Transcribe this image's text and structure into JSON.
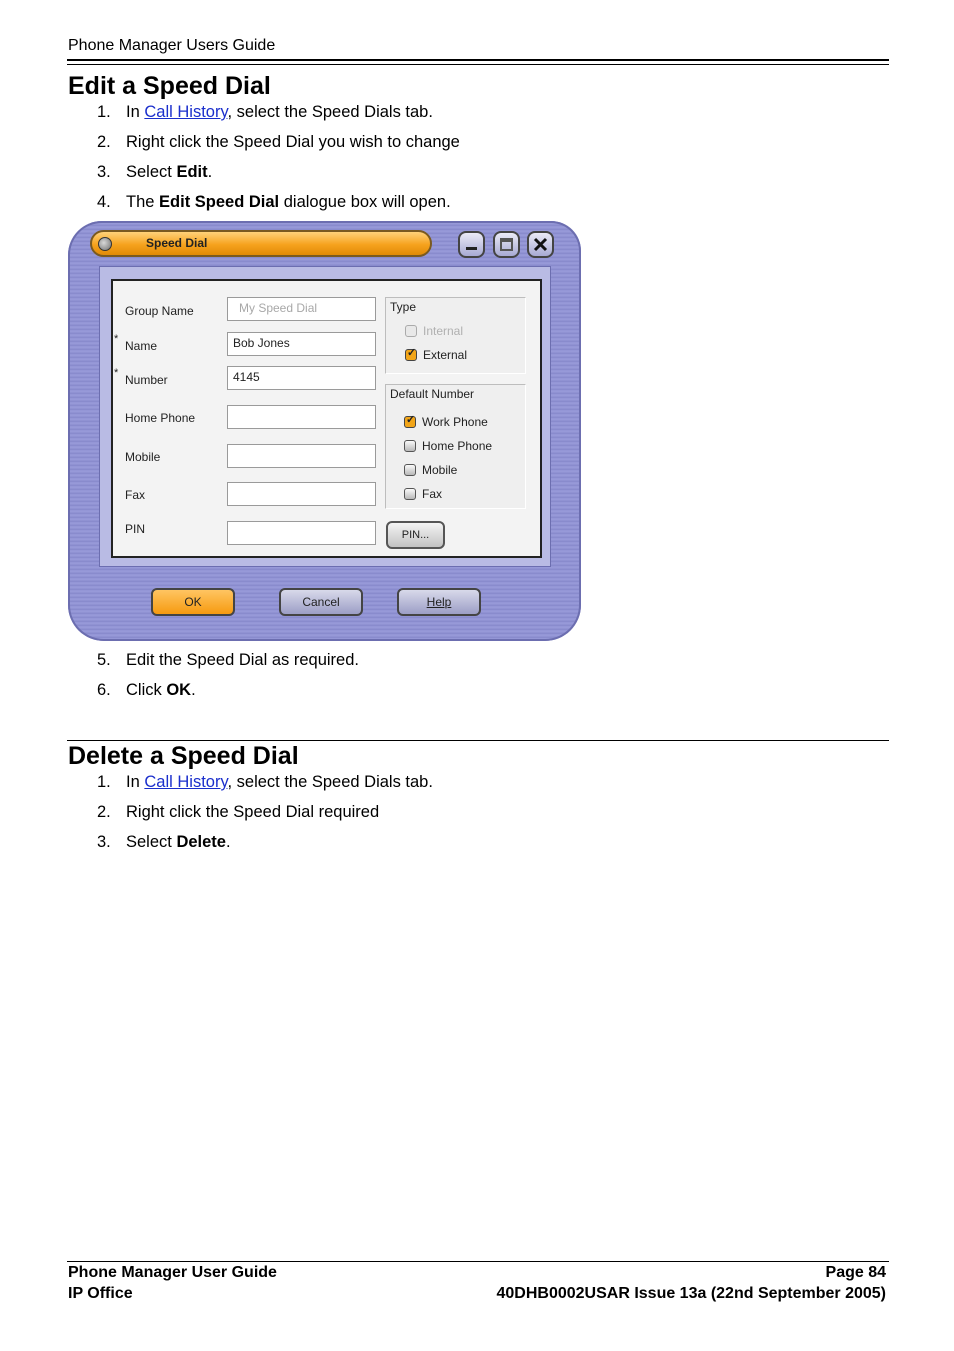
{
  "header": {
    "title": "Phone Manager Users Guide"
  },
  "section1": {
    "heading": "Edit a Speed Dial",
    "steps": [
      {
        "num": "1.",
        "pre": "In ",
        "link": "Call History",
        "post": ", select the Speed Dials tab."
      },
      {
        "num": "2.",
        "text": "Right click the Speed Dial you wish to change"
      },
      {
        "num": "3.",
        "pre": "Select ",
        "bold": "Edit",
        "post": "."
      },
      {
        "num": "4.",
        "pre": "The ",
        "bold": "Edit Speed Dial",
        "post": " dialogue box will open."
      },
      {
        "num": "5.",
        "text": "Edit the Speed Dial as required."
      },
      {
        "num": "6.",
        "pre": "Click ",
        "bold": "OK",
        "post": "."
      }
    ]
  },
  "dialog": {
    "title": "Speed Dial",
    "fields": [
      {
        "label": "Group Name",
        "required": "",
        "value": "My Speed Dial"
      },
      {
        "label": "Name",
        "required": "*",
        "value": "Bob Jones"
      },
      {
        "label": "Number",
        "required": "*",
        "value": "4145"
      },
      {
        "label": "Home Phone",
        "required": "",
        "value": ""
      },
      {
        "label": "Mobile",
        "required": "",
        "value": ""
      },
      {
        "label": "Fax",
        "required": "",
        "value": ""
      },
      {
        "label": "PIN",
        "required": "",
        "value": ""
      }
    ],
    "type_group": {
      "label": "Type",
      "options": [
        {
          "label": "Internal",
          "checked": false,
          "disabled": true
        },
        {
          "label": "External",
          "checked": true,
          "disabled": false
        }
      ]
    },
    "default_number_group": {
      "label": "Default Number",
      "options": [
        {
          "label": "Work Phone",
          "checked": true
        },
        {
          "label": "Home Phone",
          "checked": false
        },
        {
          "label": "Mobile",
          "checked": false
        },
        {
          "label": "Fax",
          "checked": false
        }
      ]
    },
    "pin_button": "PIN...",
    "buttons": {
      "ok": "OK",
      "cancel": "Cancel",
      "help": "Help"
    },
    "accent_color": "#f6a21d",
    "frame_color": "#9a9cdb"
  },
  "section2": {
    "heading": "Delete a Speed Dial",
    "steps": [
      {
        "num": "1.",
        "pre": "In ",
        "link": "Call History",
        "post": ", select the Speed Dials tab."
      },
      {
        "num": "2.",
        "text": "Right click the Speed Dial required"
      },
      {
        "num": "3.",
        "pre": "Select ",
        "bold": "Delete",
        "post": "."
      }
    ]
  },
  "footer": {
    "left_line1": "Phone Manager User Guide",
    "left_line2": "IP Office",
    "right_line1": "Page 84",
    "right_line2": "40DHB0002USAR Issue 13a (22nd September 2005)"
  }
}
